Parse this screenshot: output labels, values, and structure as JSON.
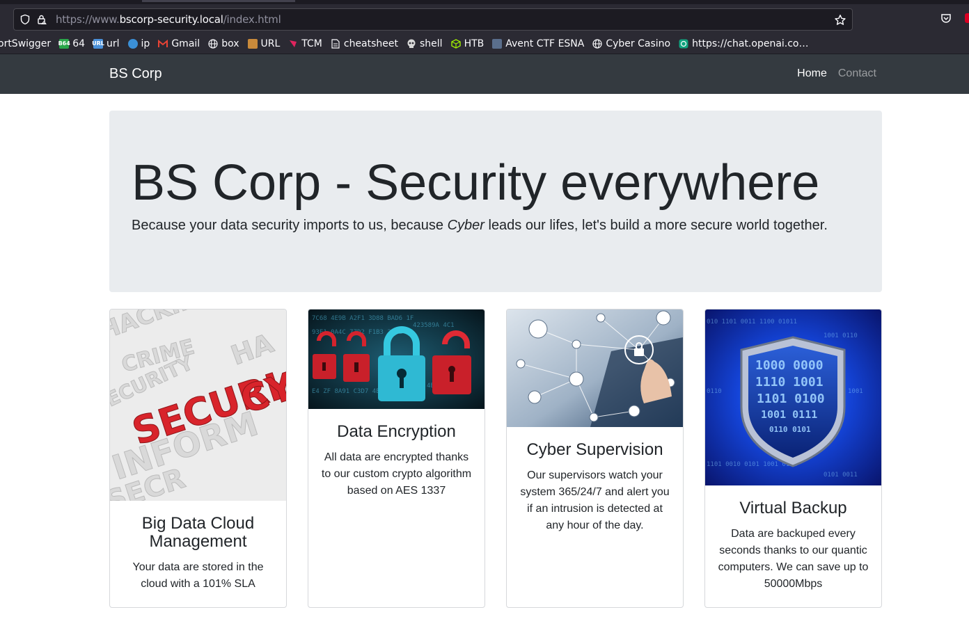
{
  "browser": {
    "url_prefix": "https://www.",
    "url_host": "bscorp-security.local",
    "url_path": "/index.html",
    "bookmarks": [
      {
        "label": "ortSwigger",
        "icon": "portswigger-icon"
      },
      {
        "label": "64",
        "icon": "base64-icon",
        "badge": "B64"
      },
      {
        "label": "url",
        "icon": "url-encoder-icon",
        "badge": "URL"
      },
      {
        "label": "ip",
        "icon": "globe-blue-icon"
      },
      {
        "label": "Gmail",
        "icon": "gmail-icon"
      },
      {
        "label": "box",
        "icon": "globe-icon"
      },
      {
        "label": "URL",
        "icon": "url-tool-icon"
      },
      {
        "label": "TCM",
        "icon": "tcm-icon"
      },
      {
        "label": "cheatsheet",
        "icon": "document-icon"
      },
      {
        "label": "shell",
        "icon": "skull-icon"
      },
      {
        "label": "HTB",
        "icon": "htb-cube-icon"
      },
      {
        "label": "Avent CTF ESNA",
        "icon": "esna-icon"
      },
      {
        "label": "Cyber Casino",
        "icon": "globe-icon"
      },
      {
        "label": "https://chat.openai.co…",
        "icon": "openai-icon"
      }
    ]
  },
  "navbar": {
    "brand": "BS Corp",
    "home": "Home",
    "contact": "Contact"
  },
  "jumbotron": {
    "heading": "BS Corp - Security everywhere",
    "lead_before": "Because your data security imports to us, because ",
    "lead_em": "Cyber",
    "lead_after": " leads our lifes, let's build a more secure world together."
  },
  "cards": [
    {
      "title": "Big Data Cloud Management",
      "text": "Your data are stored in the cloud with a 101% SLA",
      "image_words": [
        "SECURI",
        "INFORM",
        "CY",
        "HACKING",
        "CRIME"
      ]
    },
    {
      "title": "Data Encryption",
      "text": "All data are encrypted thanks to our custom crypto algorithm based on AES 1337"
    },
    {
      "title": "Cyber Supervision",
      "text": "Our supervisors watch your system 365/24/7 and alert you if an intrusion is detected at any hour of the day."
    },
    {
      "title": "Virtual Backup",
      "text": "Data are backuped every seconds thanks to our quantic computers. We can save up to 50000Mbps",
      "image_words": [
        "1000 0000",
        "1110 1001",
        "1101 0100",
        "1001 0111",
        "0110 0101"
      ]
    }
  ],
  "colors": {
    "navbar_bg": "#343a40",
    "jumbotron_bg": "#e9ecef",
    "text": "#212529",
    "browser_bg": "#2b2a33"
  }
}
